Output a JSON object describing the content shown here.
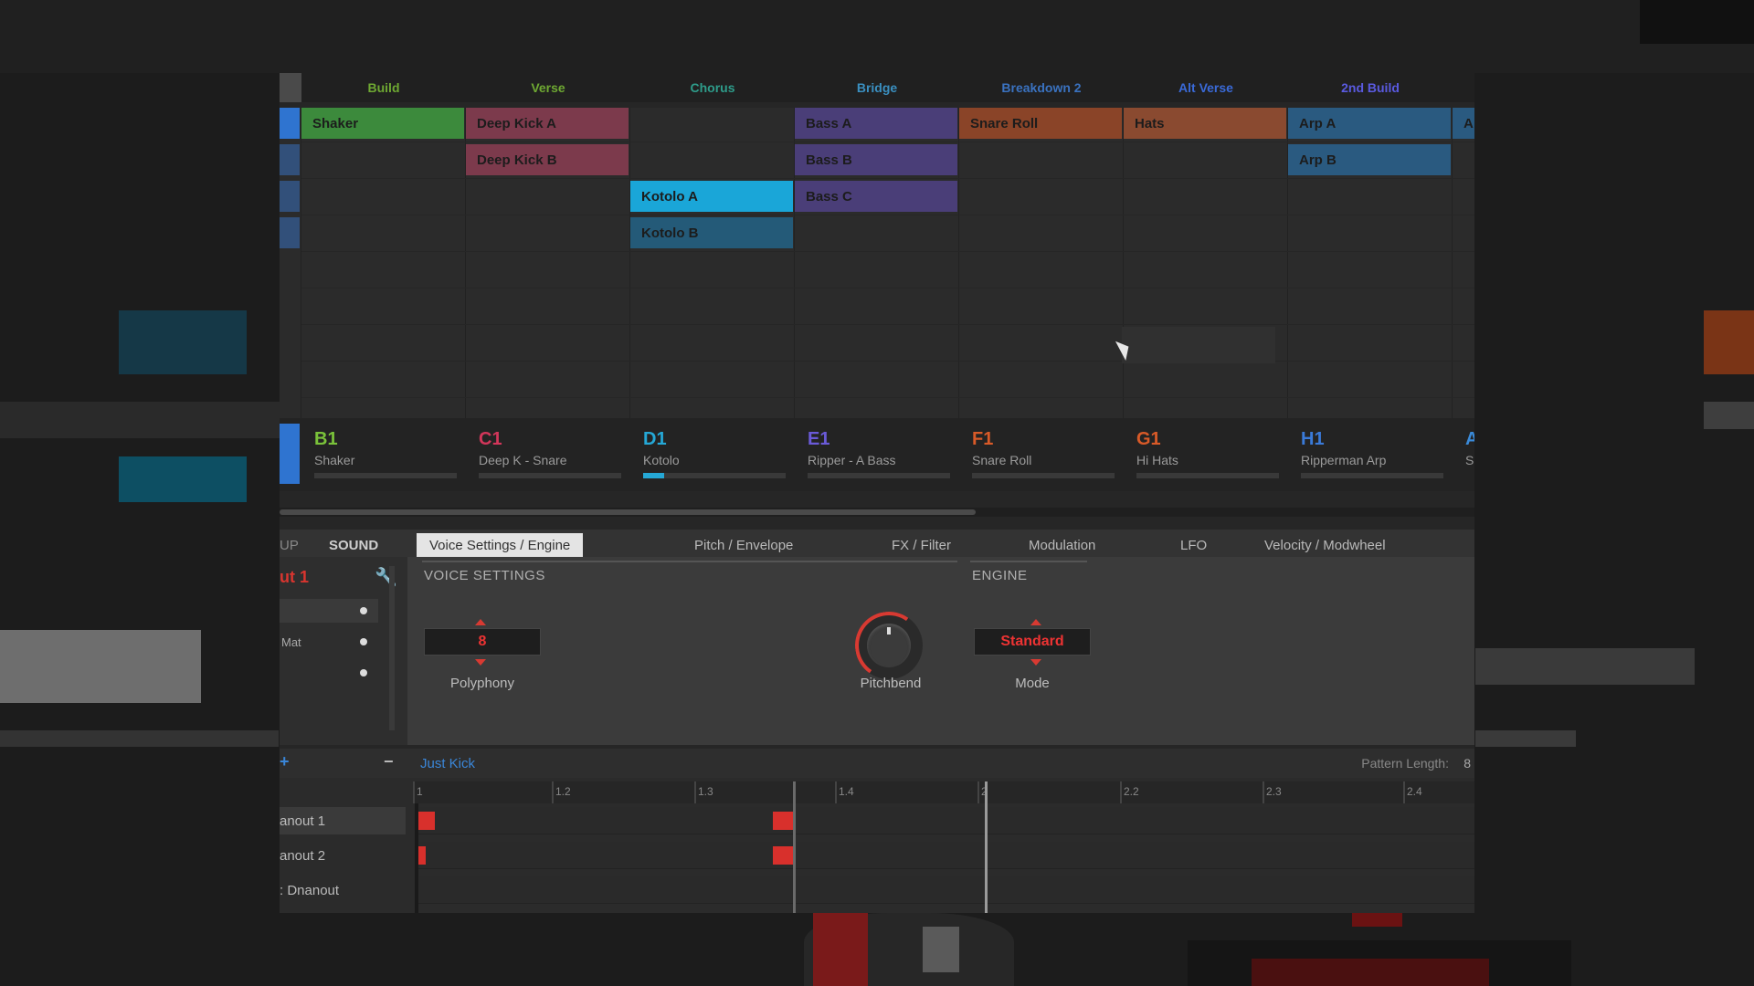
{
  "sections": [
    {
      "label": "Build",
      "color": "#6ea832"
    },
    {
      "label": "Verse",
      "color": "#6ea832"
    },
    {
      "label": "Chorus",
      "color": "#2e9c8a"
    },
    {
      "label": "Bridge",
      "color": "#3a8fc0"
    },
    {
      "label": "Breakdown 2",
      "color": "#3a72c0"
    },
    {
      "label": "Alt Verse",
      "color": "#3a6ad8"
    },
    {
      "label": "2nd Build",
      "color": "#5a5ae0"
    }
  ],
  "clips": [
    {
      "label": "Shaker",
      "col": 0,
      "row": 0,
      "color": "#3c8a3c"
    },
    {
      "label": "Deep Kick A",
      "col": 1,
      "row": 0,
      "color": "#7c3a4c"
    },
    {
      "label": "Deep Kick B",
      "col": 1,
      "row": 1,
      "color": "#7c3a4c"
    },
    {
      "label": "Kotolo A",
      "col": 2,
      "row": 2,
      "color": "#1aa6d8"
    },
    {
      "label": "Kotolo B",
      "col": 2,
      "row": 3,
      "color": "#245a78"
    },
    {
      "label": "Bass A",
      "col": 3,
      "row": 0,
      "color": "#4a3e78"
    },
    {
      "label": "Bass B",
      "col": 3,
      "row": 1,
      "color": "#4a3e78"
    },
    {
      "label": "Bass C",
      "col": 3,
      "row": 2,
      "color": "#4a3e78"
    },
    {
      "label": "Snare Roll",
      "col": 4,
      "row": 0,
      "color": "#8a4428"
    },
    {
      "label": "Hats",
      "col": 5,
      "row": 0,
      "color": "#8a4a30"
    },
    {
      "label": "Arp A",
      "col": 6,
      "row": 0,
      "color": "#2a5a80"
    },
    {
      "label": "Arp B",
      "col": 6,
      "row": 1,
      "color": "#2a5a80"
    },
    {
      "label": "A",
      "col": 7,
      "row": 0,
      "color": "#2a5a80"
    }
  ],
  "groups": [
    {
      "id": "B1",
      "name": "Shaker",
      "color": "#7ac23a",
      "level": 0
    },
    {
      "id": "C1",
      "name": "Deep K - Snare",
      "color": "#d2365a",
      "level": 0
    },
    {
      "id": "D1",
      "name": "Kotolo",
      "color": "#25a8d6",
      "level": 0.15
    },
    {
      "id": "E1",
      "name": "Ripper - A Bass",
      "color": "#6a5ad8",
      "level": 0
    },
    {
      "id": "F1",
      "name": "Snare Roll",
      "color": "#d85a28",
      "level": 0
    },
    {
      "id": "G1",
      "name": "Hi Hats",
      "color": "#d85a28",
      "level": 0
    },
    {
      "id": "H1",
      "name": "Ripperman Arp",
      "color": "#3a7ad8",
      "level": 0
    },
    {
      "id": "A",
      "name": "S",
      "color": "#3a8ad8",
      "level": 0
    }
  ],
  "plugin": {
    "up_tab": "UP",
    "sound_tab": "SOUND",
    "slot_name": "ut 1",
    "tabs": [
      "Voice Settings / Engine",
      "Pitch / Envelope",
      "FX / Filter",
      "Modulation",
      "LFO",
      "Velocity / Modwheel"
    ],
    "side_rows": [
      "",
      "Mat",
      ""
    ],
    "voice_settings_title": "VOICE SETTINGS",
    "engine_title": "ENGINE",
    "polyphony_label": "Polyphony",
    "polyphony_value": "8",
    "pitchbend_label": "Pitchbend",
    "mode_label": "Mode",
    "mode_value": "Standard"
  },
  "pattern": {
    "clip_title": "Just Kick",
    "pattern_length_label": "Pattern Length:",
    "pattern_length_value": "8",
    "ruler": [
      "1",
      "1.2",
      "1.3",
      "1.4",
      "2",
      "2.2",
      "2.3",
      "2.4"
    ],
    "lanes": [
      {
        "name": "anout 1",
        "selected": true
      },
      {
        "name": "anout 2",
        "selected": false
      },
      {
        "name": ": Dnanout",
        "selected": false
      }
    ]
  }
}
